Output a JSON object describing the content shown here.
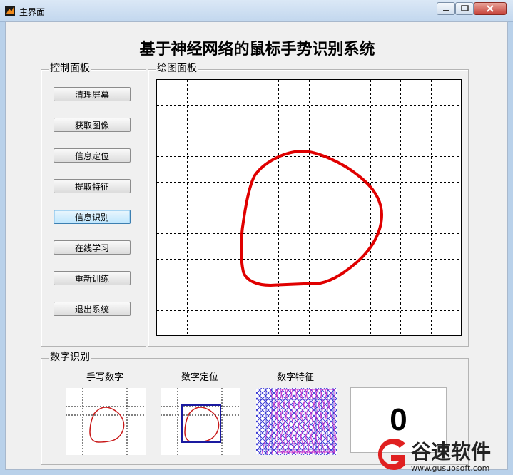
{
  "window": {
    "title": "主界面"
  },
  "app": {
    "main_title": "基于神经网络的鼠标手势识别系统"
  },
  "control_panel": {
    "label": "控制面板",
    "buttons": [
      {
        "label": "清理屏幕",
        "active": false
      },
      {
        "label": "获取图像",
        "active": false
      },
      {
        "label": "信息定位",
        "active": false
      },
      {
        "label": "提取特征",
        "active": false
      },
      {
        "label": "信息识别",
        "active": true
      },
      {
        "label": "在线学习",
        "active": false
      },
      {
        "label": "重新训练",
        "active": false
      },
      {
        "label": "退出系统",
        "active": false
      }
    ]
  },
  "drawing_panel": {
    "label": "绘图面板",
    "grid": "dashed",
    "stroke_color": "#e00000"
  },
  "digit_panel": {
    "label": "数字识别",
    "handwritten_caption": "手写数字",
    "location_caption": "数字定位",
    "feature_caption": "数字特征",
    "result": "0"
  },
  "watermark": {
    "brand": "谷速软件",
    "url": "www.gusuosoft.com"
  },
  "colors": {
    "stroke": "#e00000",
    "box": "#1a1aa0",
    "feature_blue": "#2a2ad0",
    "feature_magenta": "#cc33cc",
    "watermark_red": "#e02020"
  }
}
